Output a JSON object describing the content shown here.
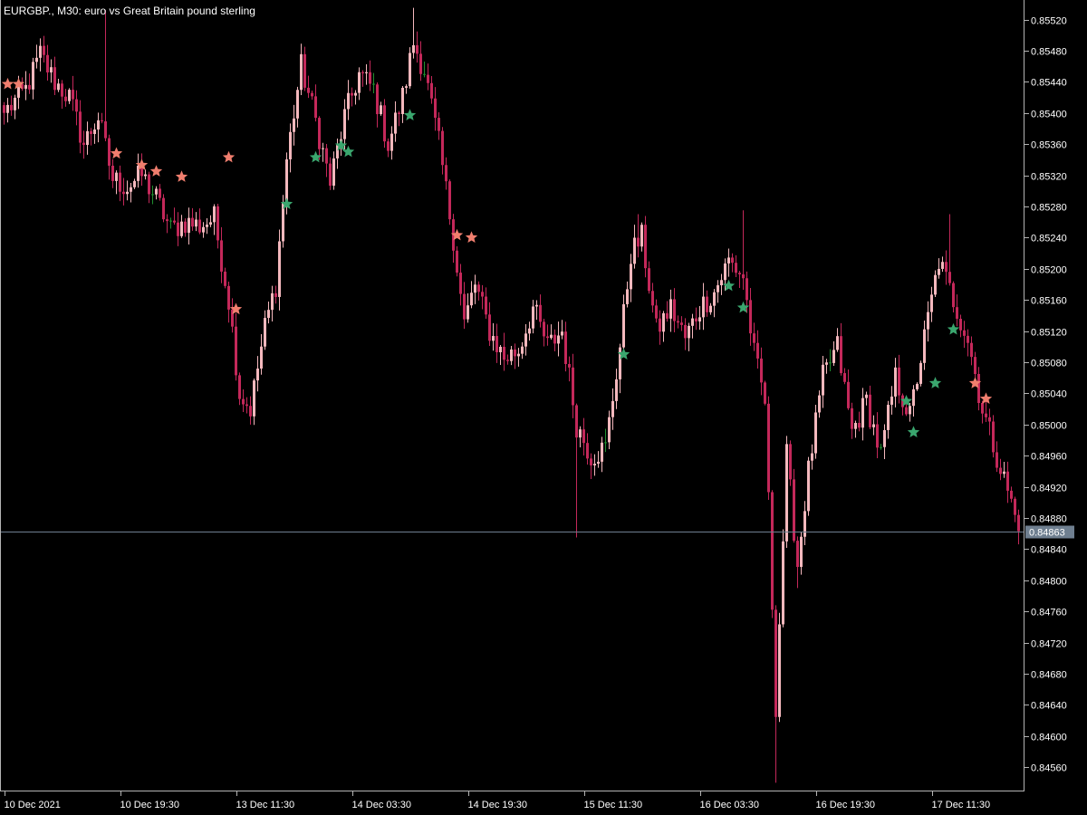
{
  "header": {
    "title": "EURGBP., M30:  euro vs Great Britain pound sterling"
  },
  "colors": {
    "background": "#000000",
    "frame": "#b4b4b4",
    "bull": "#f4b8bd",
    "bear": "#c4285a",
    "doji": "#1f8f2f",
    "star_sell": "#f07e6e",
    "star_buy": "#3aa66e",
    "current_line": "#6f7f90",
    "price_tag_bg": "#6f7f90"
  },
  "chart_data": {
    "type": "candlestick",
    "symbol": "EURGBP.",
    "timeframe": "M30",
    "ylim": [
      0.8453,
      0.85545
    ],
    "y_ticks": [
      "0.85520",
      "0.85480",
      "0.85440",
      "0.85400",
      "0.85360",
      "0.85320",
      "0.85280",
      "0.85240",
      "0.85200",
      "0.85160",
      "0.85120",
      "0.85080",
      "0.85040",
      "0.85000",
      "0.84960",
      "0.84920",
      "0.84880",
      "0.84840",
      "0.84800",
      "0.84760",
      "0.84720",
      "0.84680",
      "0.84640",
      "0.84600",
      "0.84560"
    ],
    "current_price": "0.84863",
    "x_ticks": [
      {
        "label": "10 Dec 2021",
        "bar": 0
      },
      {
        "label": "10 Dec 19:30",
        "bar": 32
      },
      {
        "label": "13 Dec 11:30",
        "bar": 64
      },
      {
        "label": "14 Dec 03:30",
        "bar": 96
      },
      {
        "label": "14 Dec 19:30",
        "bar": 128
      },
      {
        "label": "15 Dec 11:30",
        "bar": 160
      },
      {
        "label": "16 Dec 03:30",
        "bar": 192
      },
      {
        "label": "16 Dec 19:30",
        "bar": 224
      },
      {
        "label": "17 Dec 11:30",
        "bar": 256
      }
    ],
    "bar_count": 281,
    "path": [
      [
        0,
        0.854
      ],
      [
        6,
        0.8543
      ],
      [
        10,
        0.85475
      ],
      [
        14,
        0.8544
      ],
      [
        18,
        0.8542
      ],
      [
        22,
        0.8536
      ],
      [
        26,
        0.85395
      ],
      [
        30,
        0.85315
      ],
      [
        34,
        0.85305
      ],
      [
        38,
        0.8532
      ],
      [
        42,
        0.8529
      ],
      [
        46,
        0.8525
      ],
      [
        50,
        0.8526
      ],
      [
        54,
        0.85255
      ],
      [
        58,
        0.85265
      ],
      [
        62,
        0.8516
      ],
      [
        65,
        0.8504
      ],
      [
        68,
        0.8502
      ],
      [
        72,
        0.85125
      ],
      [
        75,
        0.8518
      ],
      [
        78,
        0.8534
      ],
      [
        82,
        0.8546
      ],
      [
        86,
        0.8539
      ],
      [
        90,
        0.8531
      ],
      [
        94,
        0.85395
      ],
      [
        98,
        0.8545
      ],
      [
        102,
        0.8543
      ],
      [
        106,
        0.8536
      ],
      [
        110,
        0.8542
      ],
      [
        113,
        0.8549
      ],
      [
        116,
        0.85455
      ],
      [
        120,
        0.8536
      ],
      [
        124,
        0.8524
      ],
      [
        127,
        0.8513
      ],
      [
        130,
        0.8518
      ],
      [
        134,
        0.8512
      ],
      [
        138,
        0.85085
      ],
      [
        142,
        0.85095
      ],
      [
        146,
        0.8515
      ],
      [
        150,
        0.851
      ],
      [
        154,
        0.8512
      ],
      [
        158,
        0.85
      ],
      [
        162,
        0.8496
      ],
      [
        166,
        0.8497
      ],
      [
        170,
        0.851
      ],
      [
        173,
        0.8522
      ],
      [
        176,
        0.8524
      ],
      [
        180,
        0.8512
      ],
      [
        184,
        0.8515
      ],
      [
        188,
        0.8511
      ],
      [
        192,
        0.8515
      ],
      [
        196,
        0.8517
      ],
      [
        200,
        0.8521
      ],
      [
        204,
        0.8519
      ],
      [
        207,
        0.8509
      ],
      [
        210,
        0.8503
      ],
      [
        213,
        0.8464
      ],
      [
        216,
        0.8496
      ],
      [
        219,
        0.8482
      ],
      [
        222,
        0.8494
      ],
      [
        226,
        0.8506
      ],
      [
        230,
        0.851
      ],
      [
        234,
        0.8499
      ],
      [
        238,
        0.8503
      ],
      [
        242,
        0.8496
      ],
      [
        246,
        0.8506
      ],
      [
        250,
        0.8501
      ],
      [
        254,
        0.8511
      ],
      [
        258,
        0.8521
      ],
      [
        262,
        0.8516
      ],
      [
        266,
        0.8511
      ],
      [
        270,
        0.8502
      ],
      [
        274,
        0.8496
      ],
      [
        278,
        0.849
      ],
      [
        280,
        0.84863
      ]
    ],
    "spikes": [
      {
        "bar": 28,
        "high": 0.85532
      },
      {
        "bar": 113,
        "high": 0.85535
      },
      {
        "bar": 158,
        "low": 0.84855
      },
      {
        "bar": 175,
        "high": 0.8527
      },
      {
        "bar": 204,
        "high": 0.85275
      },
      {
        "bar": 213,
        "low": 0.8454
      },
      {
        "bar": 219,
        "low": 0.8479
      },
      {
        "bar": 261,
        "high": 0.8527
      }
    ],
    "sell_stars": [
      {
        "bar": 1,
        "price": 0.85437
      },
      {
        "bar": 4,
        "price": 0.85437
      },
      {
        "bar": 31,
        "price": 0.85348
      },
      {
        "bar": 38,
        "price": 0.85333
      },
      {
        "bar": 42,
        "price": 0.85325
      },
      {
        "bar": 49,
        "price": 0.85318
      },
      {
        "bar": 62,
        "price": 0.85343
      },
      {
        "bar": 64,
        "price": 0.85148
      },
      {
        "bar": 125,
        "price": 0.85243
      },
      {
        "bar": 129,
        "price": 0.8524
      },
      {
        "bar": 268,
        "price": 0.85053
      },
      {
        "bar": 271,
        "price": 0.85033
      }
    ],
    "buy_stars": [
      {
        "bar": 78,
        "price": 0.85283
      },
      {
        "bar": 86,
        "price": 0.85343
      },
      {
        "bar": 93,
        "price": 0.85358
      },
      {
        "bar": 95,
        "price": 0.8535
      },
      {
        "bar": 112,
        "price": 0.85397
      },
      {
        "bar": 171,
        "price": 0.8509
      },
      {
        "bar": 200,
        "price": 0.85178
      },
      {
        "bar": 204,
        "price": 0.8515
      },
      {
        "bar": 249,
        "price": 0.8503
      },
      {
        "bar": 251,
        "price": 0.8499
      },
      {
        "bar": 257,
        "price": 0.85053
      },
      {
        "bar": 262,
        "price": 0.85122
      }
    ]
  }
}
